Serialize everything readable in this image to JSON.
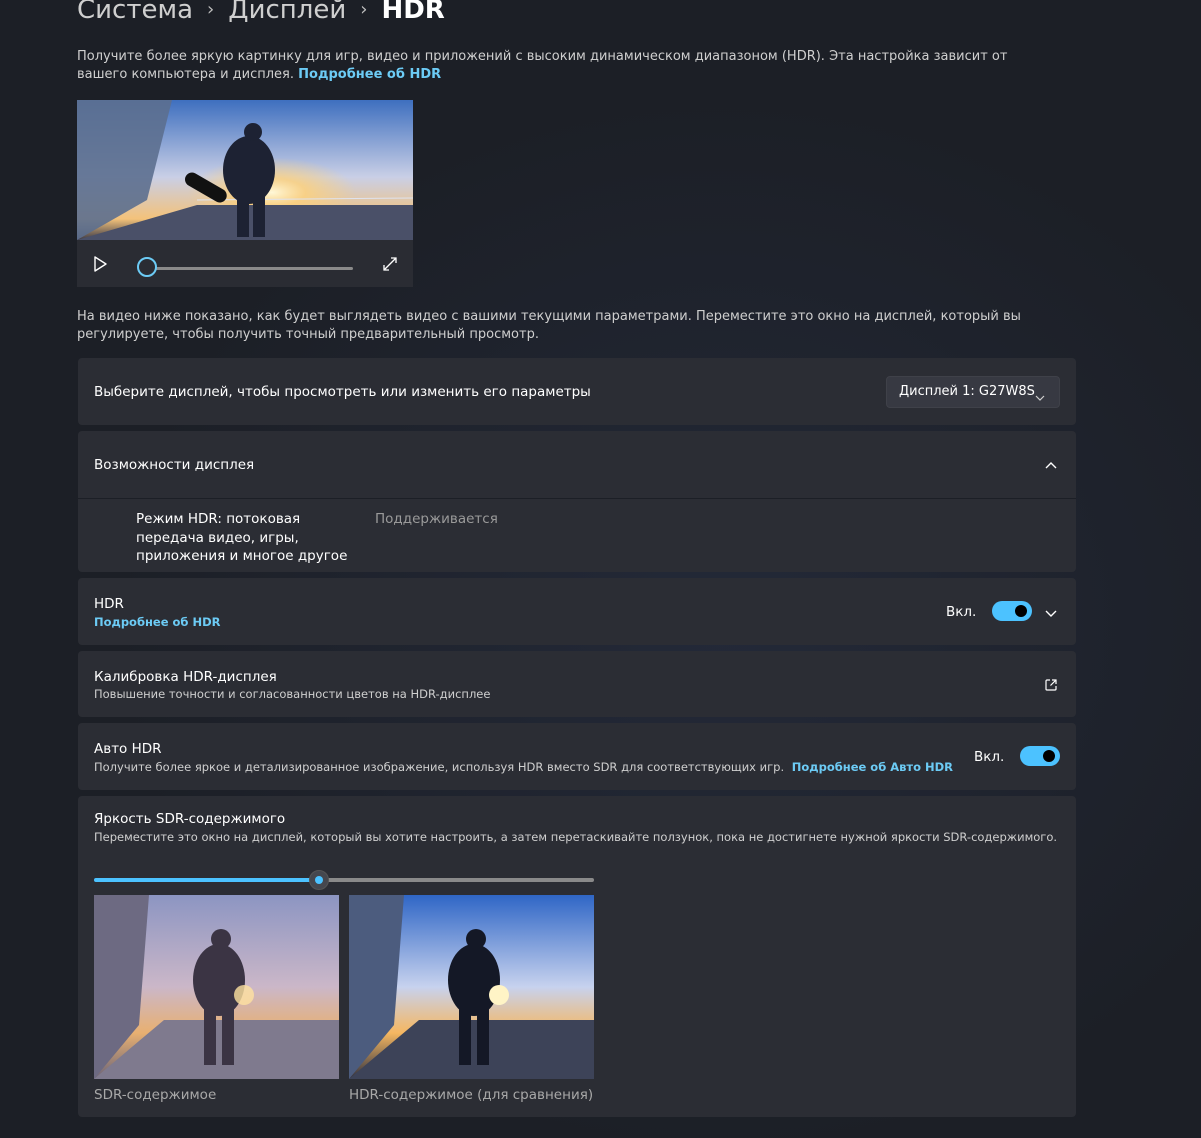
{
  "breadcrumb": {
    "items": [
      "Система",
      "Дисплей",
      "HDR"
    ],
    "separator": "›"
  },
  "intro": {
    "text": "Получите более яркую картинку для игр, видео и приложений с высоким динамическом диапазоном (HDR). Эта настройка зависит от вашего компьютера и дисплея.",
    "link": "Подробнее об HDR"
  },
  "player": {
    "progress": 0,
    "icons": {
      "play": "play-icon",
      "fullscreen": "fullscreen-icon"
    }
  },
  "note": "На видео ниже показано, как будет выглядеть видео с вашими текущими параметрами. Переместите это окно на дисплей, который вы регулируете, чтобы получить точный предварительный просмотр.",
  "display_select": {
    "label": "Выберите дисплей, чтобы просмотреть или изменить его параметры",
    "value": "Дисплей 1: G27W8S"
  },
  "capabilities": {
    "title": "Возможности дисплея",
    "expanded": true,
    "rows": [
      {
        "label": "Режим HDR: потоковая передача видео, игры, приложения и многое другое",
        "value": "Поддерживается"
      }
    ]
  },
  "hdr": {
    "title": "HDR",
    "link": "Подробнее об HDR",
    "state_label": "Вкл.",
    "on": true
  },
  "calibration": {
    "title": "Калибровка HDR-дисплея",
    "subtitle": "Повышение точности и согласованности цветов на HDR-дисплее"
  },
  "auto_hdr": {
    "title": "Авто HDR",
    "subtitle": "Получите более яркое и детализированное изображение, используя HDR вместо SDR для соответствующих игр.",
    "link": "Подробнее об Авто HDR",
    "state_label": "Вкл.",
    "on": true
  },
  "sdr_brightness": {
    "title": "Яркость SDR-содержимого",
    "subtitle": "Переместите это окно на дисплей, который вы хотите настроить, а затем перетаскивайте ползунок, пока не достигнете нужной яркости SDR-содержимого.",
    "value_fraction": 0.45,
    "captions": [
      "SDR-содержимое",
      "HDR-содержимое (для сравнения)"
    ]
  },
  "colors": {
    "accent": "#4cc2ff",
    "link": "#6ccbf5",
    "card": "#2b2d34",
    "background": "#1c1f26"
  }
}
